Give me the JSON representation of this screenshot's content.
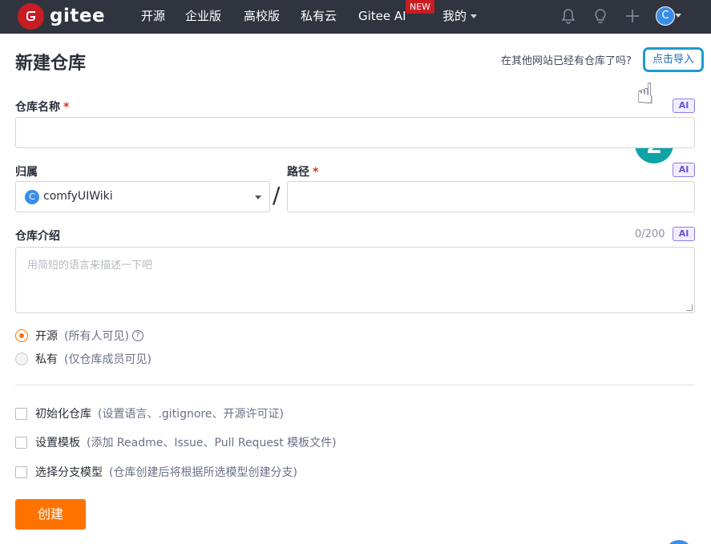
{
  "nav": {
    "logo_text": "gitee",
    "items": [
      "开源",
      "企业版",
      "高校版",
      "私有云",
      "Gitee AI",
      "我的"
    ],
    "new_badge": "NEW",
    "avatar_letter": "C",
    "icons": [
      "bell-icon",
      "lightbulb-icon",
      "plus-icon",
      "avatar"
    ]
  },
  "header": {
    "title": "新建仓库",
    "import_prompt": "在其他网站已经有仓库了吗?",
    "import_link": "点击导入"
  },
  "annotation": {
    "hand": "☝",
    "step_number": "2"
  },
  "form": {
    "repo_name_label": "仓库名称",
    "required_mark": "*",
    "ai_label": "AI",
    "owner_label": "归属",
    "owner_avatar": "C",
    "owner_value": "comfyUIWiki",
    "slash": "/",
    "path_label": "路径",
    "desc_label": "仓库介绍",
    "desc_counter": "0/200",
    "desc_placeholder": "用简短的语言来描述一下吧",
    "visibility": [
      {
        "label": "开源",
        "hint": "(所有人可见)",
        "selected": true
      },
      {
        "label": "私有",
        "hint": "(仅仓库成员可见)",
        "selected": false
      }
    ],
    "help_icon": "?",
    "options": [
      {
        "label": "初始化仓库",
        "hint": "(设置语言、.gitignore、开源许可证)"
      },
      {
        "label": "设置模板",
        "hint": "(添加 Readme、Issue、Pull Request 模板文件)"
      },
      {
        "label": "选择分支模型",
        "hint": "(仓库创建后将根据所选模型创建分支)"
      }
    ],
    "submit_label": "创建"
  },
  "colors": {
    "nav_bg": "#30343f",
    "brand_red": "#c71d23",
    "accent_orange": "#fe7300",
    "link_blue": "#1c6fb5",
    "step_teal": "#10a3a6"
  }
}
